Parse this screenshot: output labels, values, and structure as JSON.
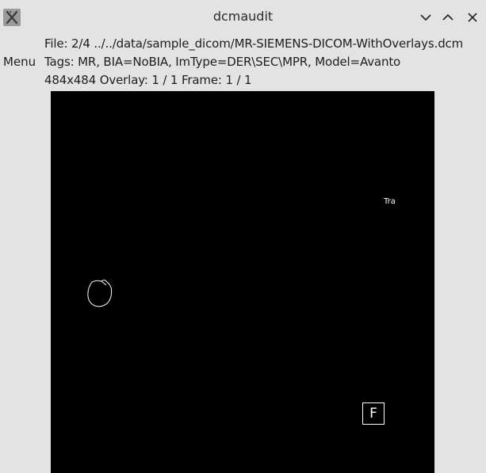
{
  "window": {
    "title": "dcmaudit",
    "app_icon": "x-app-icon",
    "controls": [
      "minimize-icon",
      "maximize-icon",
      "close-icon"
    ]
  },
  "menu": {
    "label": "Menu"
  },
  "info": {
    "file_line": "File: 2/4 ../../data/sample_dicom/MR-SIEMENS-DICOM-WithOverlays.dcm",
    "tags_line": "Tags: MR, BIA=NoBIA, ImType=DER\\SEC\\MPR, Model=Avanto",
    "dims_line": "484x484 Overlay: 1 / 1 Frame: 1 / 1"
  },
  "viewer": {
    "background": "#000000",
    "overlay_text": "Tra",
    "overlay_letter": "F",
    "overlay_color": "#ffffff"
  },
  "colors": {
    "window_bg": "#e3e3e3",
    "text": "#1e1e1e",
    "icon_bg": "#9a9a9a"
  }
}
